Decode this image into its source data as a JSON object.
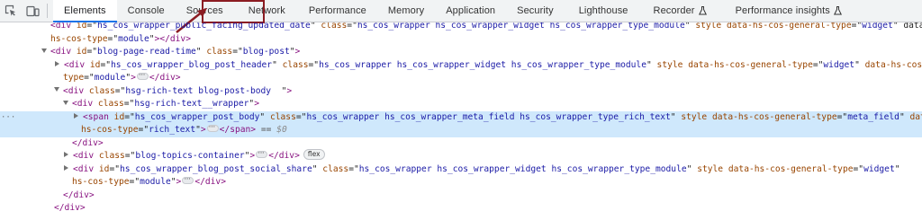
{
  "toolbar": {
    "tabs": [
      {
        "label": "Elements",
        "active": true
      },
      {
        "label": "Console"
      },
      {
        "label": "Sources"
      },
      {
        "label": "Network",
        "highlighted": true
      },
      {
        "label": "Performance"
      },
      {
        "label": "Memory"
      },
      {
        "label": "Application"
      },
      {
        "label": "Security"
      },
      {
        "label": "Lighthouse"
      },
      {
        "label": "Recorder",
        "experimental": true
      },
      {
        "label": "Performance insights",
        "experimental": true
      }
    ],
    "icons": [
      "inspect-element-icon",
      "device-toolbar-icon"
    ]
  },
  "tree": {
    "line0": {
      "tag_open": "<div",
      "a1n": "id",
      "a1v": "hs_cos_wrapper_public_facing_updated_date",
      "a2n": "class",
      "a2v": "hs_cos_wrapper hs_cos_wrapper_widget hs_cos_wrapper_type_module",
      "a3n": "style",
      "a4n": "data-hs-cos-general-type",
      "a4v": "widget",
      "cont": "hs-cos-type",
      "cont_v": "module",
      "close": "</div>"
    },
    "line1": {
      "tag": "<div",
      "an": "id",
      "av": "blog-page-read-time",
      "an2": "class",
      "av2": "blog-post"
    },
    "line2": {
      "tag": "<div",
      "an": "id",
      "av": "hs_cos_wrapper_blog_post_header",
      "an2": "class",
      "av2": "hs_cos_wrapper hs_cos_wrapper_widget hs_cos_wrapper_type_module",
      "an3": "style",
      "an4": "data-hs-cos-general-type",
      "av4": "widget",
      "an5": "data-hs-cos-",
      "cont": "type",
      "cont_v": "module",
      "close": "</div>"
    },
    "line3": {
      "tag": "<div",
      "an": "class",
      "av": "hsg-rich-text blog-post-body  "
    },
    "line4": {
      "tag": "<div",
      "an": "class",
      "av": "hsg-rich-text__wrapper"
    },
    "line5": {
      "tag": "<span",
      "an": "id",
      "av": "hs_cos_wrapper_post_body",
      "an2": "class",
      "av2": "hs_cos_wrapper hs_cos_wrapper_meta_field hs_cos_wrapper_type_rich_text",
      "an3": "style",
      "an4": "data-hs-cos-general-type",
      "av4": "meta_field",
      "an5": "data-",
      "cont": "hs-cos-type",
      "cont_v": "rich_text",
      "close": "</span>",
      "marker": "== ",
      "dollar": "$0"
    },
    "line6": {
      "close": "</div>"
    },
    "line7": {
      "tag": "<div",
      "an": "class",
      "av": "blog-topics-container",
      "close": "</div>",
      "badge": "flex"
    },
    "line8": {
      "tag": "<div",
      "an": "id",
      "av": "hs_cos_wrapper_blog_post_social_share",
      "an2": "class",
      "av2": "hs_cos_wrapper hs_cos_wrapper_widget hs_cos_wrapper_type_module",
      "an3": "style",
      "an4": "data-hs-cos-general-type",
      "av4": "widget",
      "cont": "hs-cos-type",
      "cont_v": "module",
      "close": "</div>"
    },
    "line9": {
      "close": "</div>"
    },
    "line10": {
      "close": "</div>"
    }
  },
  "colors": {
    "annotation": "#8b1c22",
    "selected_row": "#cfe8fc",
    "active_tab_underline": "#1a73e8"
  }
}
